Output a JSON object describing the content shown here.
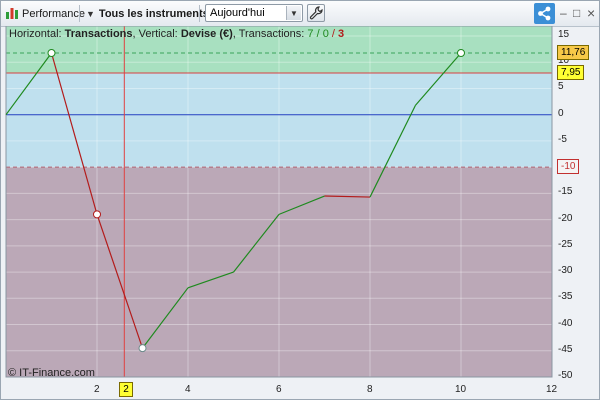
{
  "toolbar": {
    "app_label": "Performance",
    "instruments_label": "Tous les instruments",
    "period_value": "Aujourd'hui",
    "app_icon": "bar-chart-icon",
    "wrench_icon": "wrench-icon",
    "share_icon": "share-icon",
    "minimize_glyph": "–",
    "restore_glyph": "□",
    "close_glyph": "×"
  },
  "info": {
    "horizontal_label": "Horizontal:",
    "horizontal_value": "Transactions",
    "vertical_label": ", Vertical:",
    "vertical_value": "Devise (€)",
    "transactions_label": ", Transactions:",
    "win_count": "7",
    "slash1": " / ",
    "flat_count": "0",
    "slash2": " / ",
    "loss_count": "3"
  },
  "watermark": "© IT-Finance.com",
  "price_tags": {
    "max": "11,76",
    "current": "7,95",
    "min": "-10"
  },
  "cursor_x_label": "2",
  "colors": {
    "profit_zone": "#a8e0c0",
    "neutral_zone": "#bfe0ee",
    "loss_zone": "#bba8b7",
    "up_line": "#1f8a1f",
    "down_line": "#b31b1b",
    "zero_line": "#1f3fbf",
    "accent": "#3b8fd6"
  },
  "chart_data": {
    "type": "line",
    "x": [
      0,
      1,
      2,
      3,
      4,
      5,
      6,
      7,
      8,
      9,
      10
    ],
    "values": [
      0,
      11.76,
      -19,
      -44.5,
      -33,
      -30,
      -19,
      -15.5,
      -15.7,
      1.8,
      11.76
    ],
    "xlim": [
      0,
      12
    ],
    "ylim": [
      -50,
      15
    ],
    "x_ticks": [
      "2",
      "4",
      "6",
      "8",
      "10",
      "12"
    ],
    "y_ticks": [
      "15",
      "10",
      "5",
      "0",
      "-5",
      "-10",
      "-15",
      "-20",
      "-25",
      "-30",
      "-35",
      "-40",
      "-45",
      "-50"
    ],
    "reference_lines": {
      "max": 11.76,
      "current": 7.95,
      "min": -10,
      "zero": 0
    },
    "cursor_x": 2.6,
    "grid": true
  }
}
